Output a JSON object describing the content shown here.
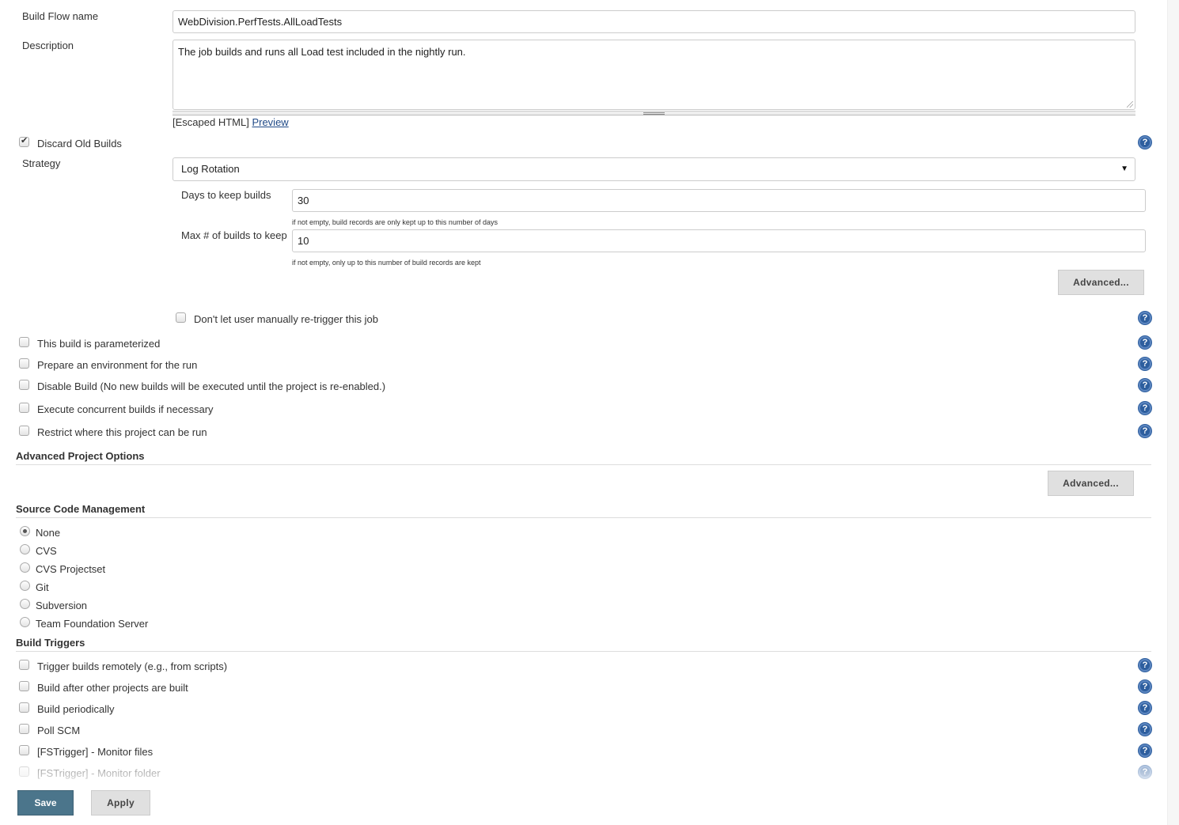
{
  "general": {
    "name_label": "Build Flow name",
    "name_value": "WebDivision.PerfTests.AllLoadTests",
    "description_label": "Description",
    "description_value": "The job builds and runs all Load test included in the nightly run.",
    "escaped_html": "[Escaped HTML]",
    "preview_link": "Preview"
  },
  "discard": {
    "label": "Discard Old Builds",
    "checked": true,
    "strategy_label": "Strategy",
    "strategy_value": "Log Rotation",
    "days_label": "Days to keep builds",
    "days_value": "30",
    "days_hint": "if not empty, build records are only kept up to this number of days",
    "max_label": "Max # of builds to keep",
    "max_value": "10",
    "max_hint": "if not empty, only up to this number of build records are kept",
    "advanced_button": "Advanced...",
    "retrigger_label": "Don't let user manually re-trigger this job"
  },
  "options": [
    {
      "label": "This build is parameterized",
      "checked": false
    },
    {
      "label": "Prepare an environment for the run",
      "checked": false
    },
    {
      "label": "Disable Build (No new builds will be executed until the project is re-enabled.)",
      "checked": false
    },
    {
      "label": "Execute concurrent builds if necessary",
      "checked": false
    },
    {
      "label": "Restrict where this project can be run",
      "checked": false
    }
  ],
  "advanced_project": {
    "title": "Advanced Project Options",
    "advanced_button": "Advanced..."
  },
  "scm": {
    "title": "Source Code Management",
    "selected": "None",
    "options": [
      "None",
      "CVS",
      "CVS Projectset",
      "Git",
      "Subversion",
      "Team Foundation Server"
    ]
  },
  "triggers": {
    "title": "Build Triggers",
    "items": [
      {
        "label": "Trigger builds remotely (e.g., from scripts)",
        "checked": false
      },
      {
        "label": "Build after other projects are built",
        "checked": false
      },
      {
        "label": "Build periodically",
        "checked": false
      },
      {
        "label": "Poll SCM",
        "checked": false
      },
      {
        "label": "[FSTrigger] - Monitor files",
        "checked": false
      },
      {
        "label": "[FSTrigger] - Monitor folder",
        "checked": false
      }
    ]
  },
  "footer": {
    "save": "Save",
    "apply": "Apply"
  },
  "icons": {
    "help": "?"
  },
  "colors": {
    "save_button": "#4b758b",
    "help_icon": "#2d5e9e",
    "link": "#204a87"
  }
}
